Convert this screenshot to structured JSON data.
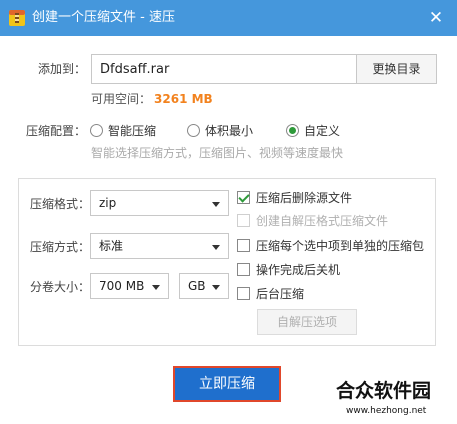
{
  "window": {
    "title": "创建一个压缩文件 - 速压",
    "close_glyph": "✕"
  },
  "target": {
    "label": "添加到：",
    "filename": "Dfdsaff.rar",
    "change_dir_label": "更换目录",
    "available_space_label": "可用空间：",
    "available_space_value": "3261 MB"
  },
  "config": {
    "label": "压缩配置：",
    "options": [
      {
        "label": "智能压缩",
        "selected": false
      },
      {
        "label": "体积最小",
        "selected": false
      },
      {
        "label": "自定义",
        "selected": true
      }
    ],
    "hint": "智能选择压缩方式，压缩图片、视频等速度最快"
  },
  "settings": {
    "format_label": "压缩格式：",
    "format_value": "zip",
    "method_label": "压缩方式：",
    "method_value": "标准",
    "volume_label": "分卷大小：",
    "volume_value": "700 MB",
    "volume_unit": "GB"
  },
  "checkboxes": [
    {
      "label": "压缩后删除源文件",
      "checked": true,
      "disabled": false
    },
    {
      "label": "创建自解压格式压缩文件",
      "checked": false,
      "disabled": true
    },
    {
      "label": "压缩每个选中项到单独的压缩包",
      "checked": false,
      "disabled": false
    },
    {
      "label": "操作完成后关机",
      "checked": false,
      "disabled": false
    },
    {
      "label": "后台压缩",
      "checked": false,
      "disabled": false
    }
  ],
  "sfx_options_label": "自解压选项",
  "compress_button_label": "立即压缩",
  "watermark": {
    "name": "合众软件园",
    "url": "www.hezhong.net"
  },
  "colors": {
    "titlebar": "#4597dc",
    "accent_orange": "#f2821e",
    "primary_button": "#1f6fcd",
    "check_green": "#2e9a3a"
  }
}
